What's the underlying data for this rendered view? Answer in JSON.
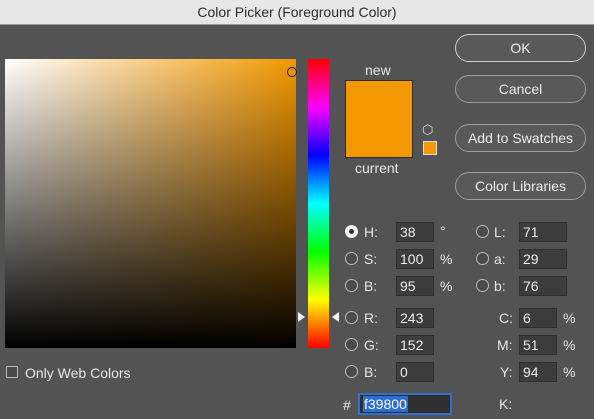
{
  "window": {
    "title": "Color Picker (Foreground Color)"
  },
  "colors": {
    "current_hex": "#f39800",
    "accent": "#2f6fd3"
  },
  "preview": {
    "new_label": "new",
    "current_label": "current"
  },
  "buttons": {
    "ok": "OK",
    "cancel": "Cancel",
    "add_to_swatches": "Add to Swatches",
    "color_libraries": "Color Libraries"
  },
  "only_web_colors": {
    "label": "Only Web Colors",
    "checked": false
  },
  "hsb": {
    "h": {
      "label": "H:",
      "value": "38",
      "unit": "°",
      "selected": true
    },
    "s": {
      "label": "S:",
      "value": "100",
      "unit": "%"
    },
    "b": {
      "label": "B:",
      "value": "95",
      "unit": "%"
    }
  },
  "rgb": {
    "r": {
      "label": "R:",
      "value": "243"
    },
    "g": {
      "label": "G:",
      "value": "152"
    },
    "b": {
      "label": "B:",
      "value": "0"
    }
  },
  "lab": {
    "l": {
      "label": "L:",
      "value": "71"
    },
    "a": {
      "label": "a:",
      "value": "29"
    },
    "b": {
      "label": "b:",
      "value": "76"
    }
  },
  "cmyk": {
    "c": {
      "label": "C:",
      "value": "6",
      "unit": "%"
    },
    "m": {
      "label": "M:",
      "value": "51",
      "unit": "%"
    },
    "y": {
      "label": "Y:",
      "value": "94",
      "unit": "%"
    },
    "k": {
      "label": "K:"
    }
  },
  "hex": {
    "label": "#",
    "value": "f39800"
  }
}
